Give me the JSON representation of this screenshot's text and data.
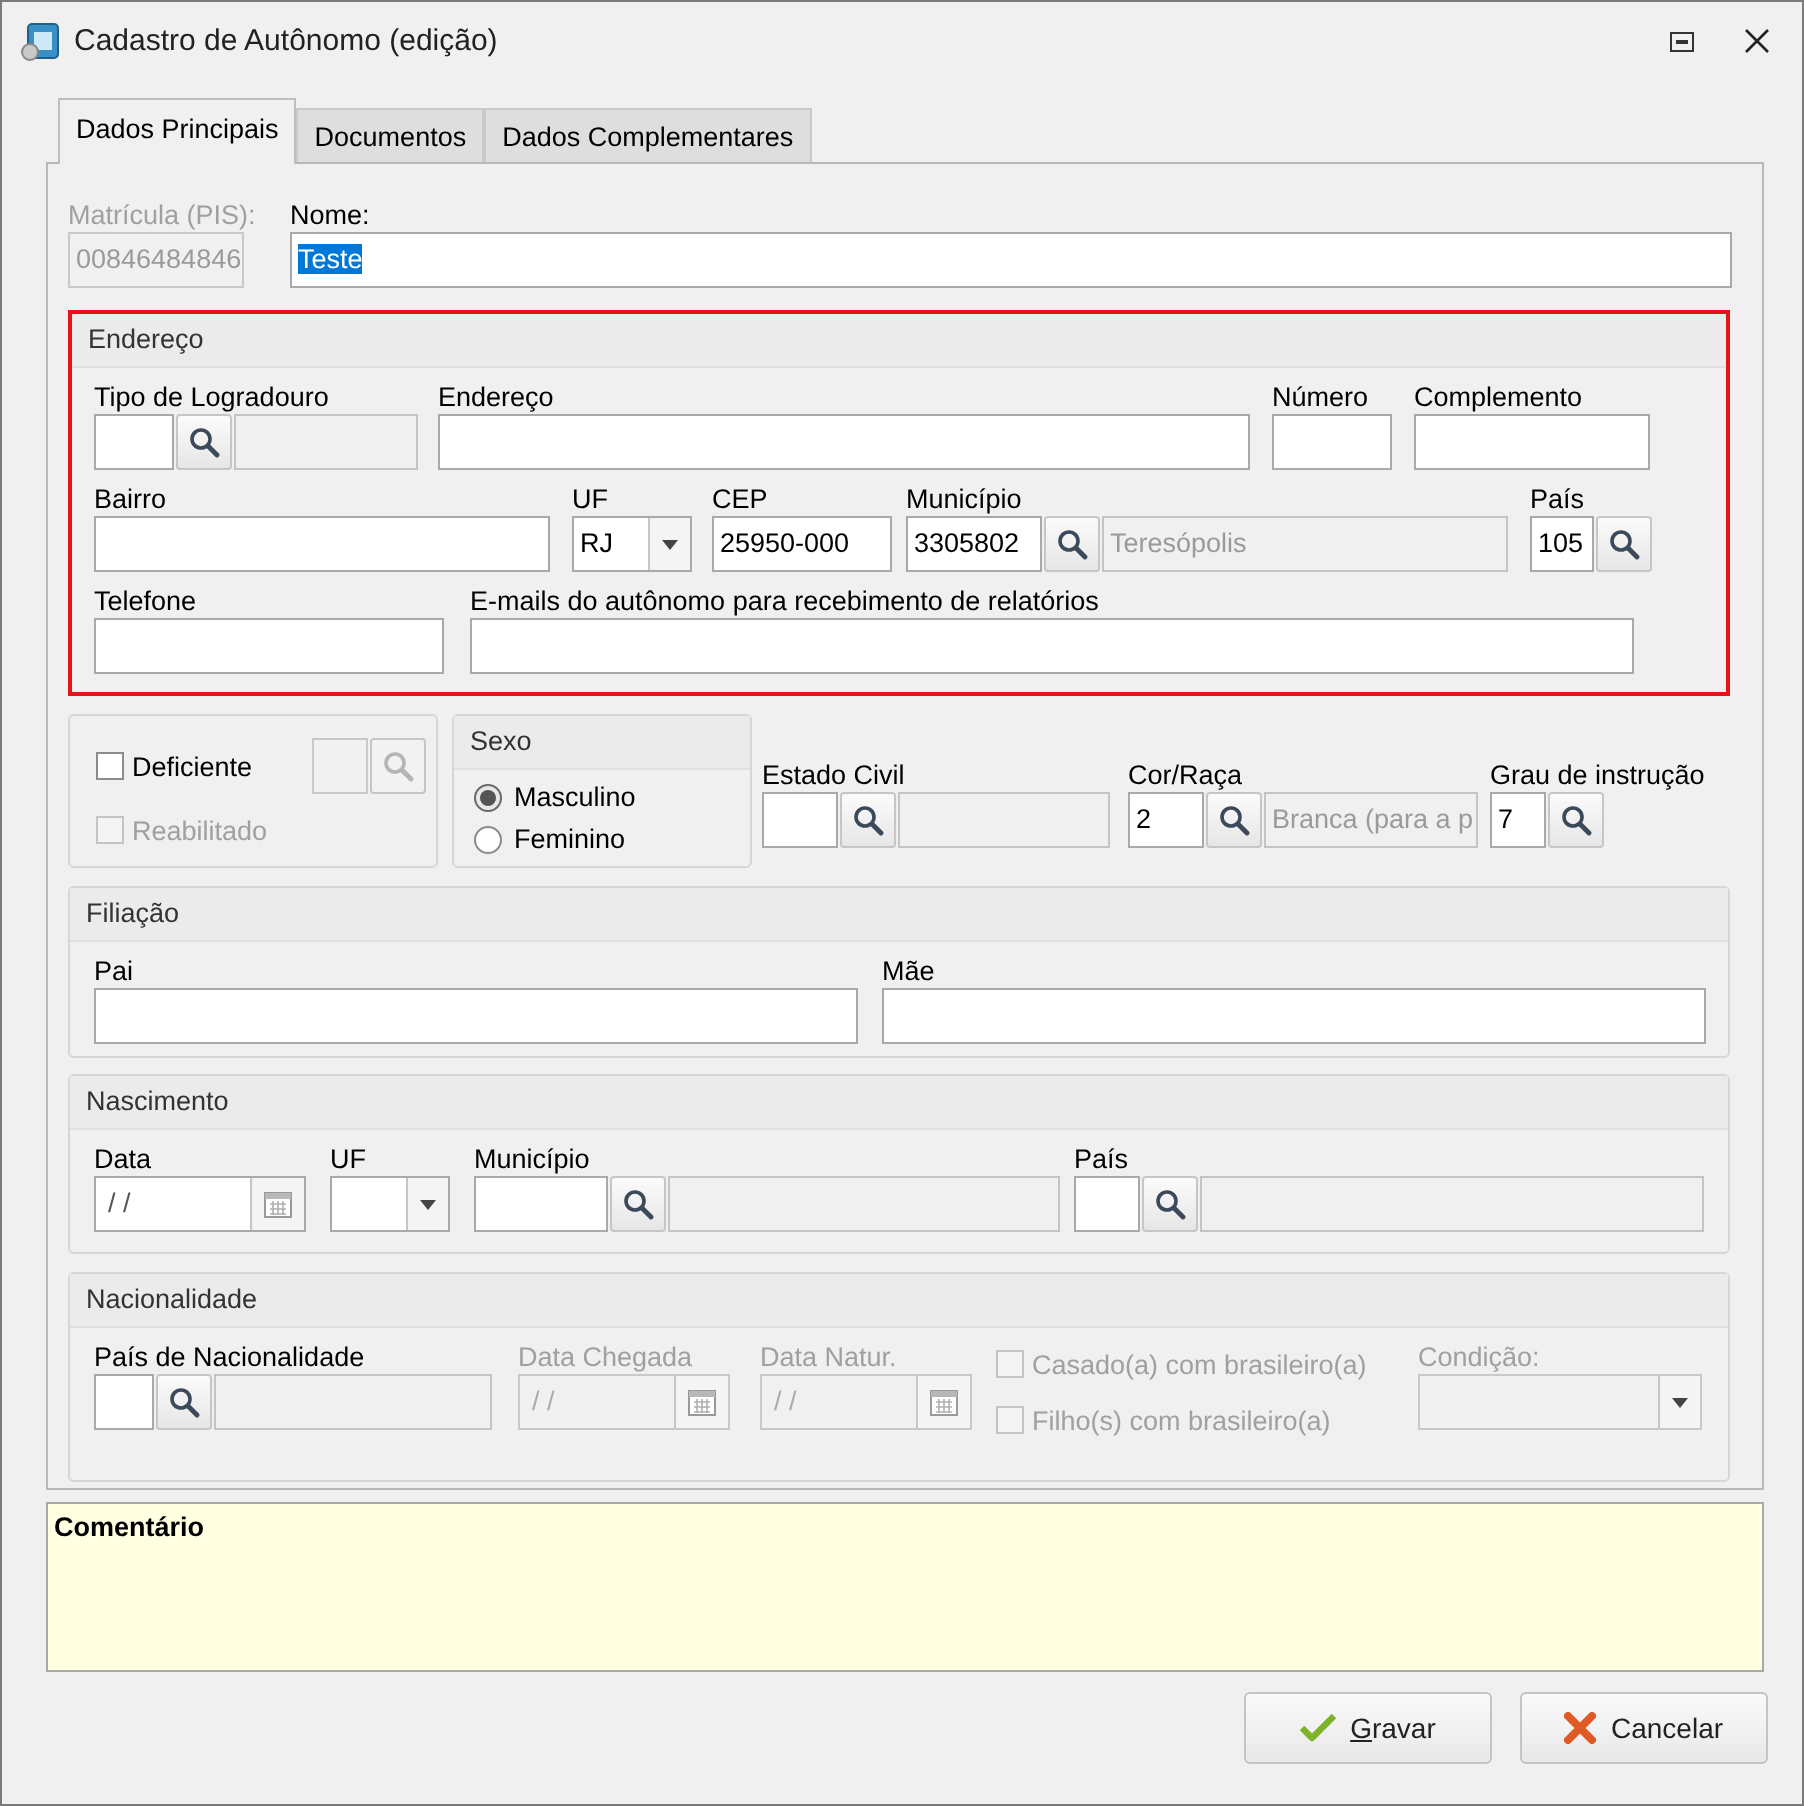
{
  "window": {
    "title": "Cadastro de Autônomo (edição)"
  },
  "tabs": [
    {
      "label": "Dados Principais",
      "selected": true
    },
    {
      "label": "Documentos",
      "selected": false
    },
    {
      "label": "Dados Complementares",
      "selected": false
    }
  ],
  "top": [
    {
      "kind": "text",
      "label": "Matrícula (PIS):",
      "value": "00846484846",
      "disabled": true
    },
    {
      "kind": "text",
      "label": "Nome:",
      "value": "Teste",
      "highlighted": true
    }
  ],
  "address": {
    "title": "Endereço",
    "highlighted": true,
    "lines": [
      {
        "fields": [
          {
            "kind": "lookup_desc",
            "label": "Tipo de Logradouro"
          },
          {
            "kind": "text",
            "label": "Endereço"
          },
          {
            "kind": "text",
            "label": "Número"
          },
          {
            "kind": "text",
            "label": "Complemento"
          }
        ]
      },
      {
        "fields": [
          {
            "kind": "text",
            "label": "Bairro"
          },
          {
            "kind": "combo",
            "label": "UF",
            "value": "RJ"
          },
          {
            "kind": "text",
            "label": "CEP",
            "value": "25950-000"
          },
          {
            "kind": "lookup_desc",
            "label": "Município",
            "value": "3305802",
            "description": "Teresópolis"
          },
          {
            "kind": "lookup",
            "label": "País",
            "value": "105"
          }
        ]
      },
      {
        "fields": [
          {
            "kind": "text",
            "label": "Telefone"
          },
          {
            "kind": "text",
            "label": "E-mails do autônomo para recebimento de relatórios"
          }
        ]
      }
    ]
  },
  "personal": [
    {
      "kind": "panel",
      "items": [
        {
          "label": "Deficiente",
          "checked": false,
          "disabled": false
        },
        {
          "label": "Reabilitado",
          "checked": false,
          "disabled": true
        }
      ],
      "lookup_disabled": true
    },
    {
      "kind": "radio_group",
      "title": "Sexo",
      "options": [
        {
          "label": "Masculino",
          "selected": true
        },
        {
          "label": "Feminino",
          "selected": false
        }
      ]
    },
    {
      "kind": "lookup_desc",
      "label": "Estado Civil"
    },
    {
      "kind": "lookup_desc",
      "label": "Cor/Raça",
      "value": "2",
      "description": "Branca (para a p"
    },
    {
      "kind": "lookup",
      "label": "Grau de instrução",
      "value": "7"
    }
  ],
  "filiation": {
    "title": "Filiação",
    "lines": [
      {
        "fields": [
          {
            "kind": "text",
            "label": "Pai"
          },
          {
            "kind": "text",
            "label": "Mãe"
          }
        ]
      }
    ]
  },
  "birth": {
    "title": "Nascimento",
    "lines": [
      {
        "fields": [
          {
            "kind": "date",
            "label": "Data",
            "value": "/ /"
          },
          {
            "kind": "combo",
            "label": "UF"
          },
          {
            "kind": "lookup_desc",
            "label": "Município"
          },
          {
            "kind": "lookup_desc",
            "label": "País"
          }
        ]
      }
    ]
  },
  "nationality": {
    "title": "Nacionalidade",
    "lines": [
      {
        "fields": [
          {
            "kind": "lookup_desc",
            "label": "País de Nacionalidade"
          },
          {
            "kind": "date",
            "label": "Data Chegada",
            "value": "/ /",
            "disabled": true
          },
          {
            "kind": "date",
            "label": "Data Natur.",
            "value": "/ /",
            "disabled": true
          },
          {
            "kind": "checks",
            "items": [
              {
                "label": "Casado(a) com brasileiro(a)",
                "checked": false,
                "disabled": true
              },
              {
                "label": "Filho(s) com brasileiro(a)",
                "checked": false,
                "disabled": true
              }
            ]
          },
          {
            "kind": "combo",
            "label": "Condição:",
            "disabled": true
          }
        ]
      }
    ]
  },
  "comment": {
    "label": "Comentário"
  },
  "buttons": [
    {
      "label": "Gravar",
      "kind": "confirm",
      "mnemonic": true
    },
    {
      "label": "Cancelar",
      "kind": "cancel",
      "mnemonic": false
    }
  ]
}
